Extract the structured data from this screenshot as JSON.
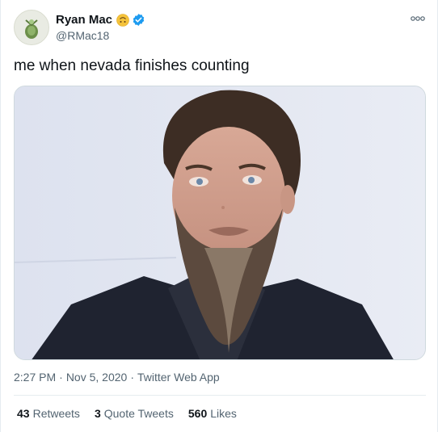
{
  "author": {
    "display_name": "Ryan Mac",
    "handle": "@RMac18",
    "emoji_icon": "upside-down-face-icon",
    "verified_icon": "verified-badge-icon"
  },
  "tweet": {
    "text": "me when nevada finishes counting",
    "time": "2:27 PM",
    "date": "Nov 5, 2020",
    "source": "Twitter Web App",
    "separator": "·"
  },
  "stats": [
    {
      "count": "43",
      "label": "Retweets"
    },
    {
      "count": "3",
      "label": "Quote Tweets"
    },
    {
      "count": "560",
      "label": "Likes"
    }
  ],
  "colors": {
    "text": "#0f1419",
    "secondary": "#536471",
    "verified": "#1d9bf0",
    "border": "#e6ecf0"
  }
}
